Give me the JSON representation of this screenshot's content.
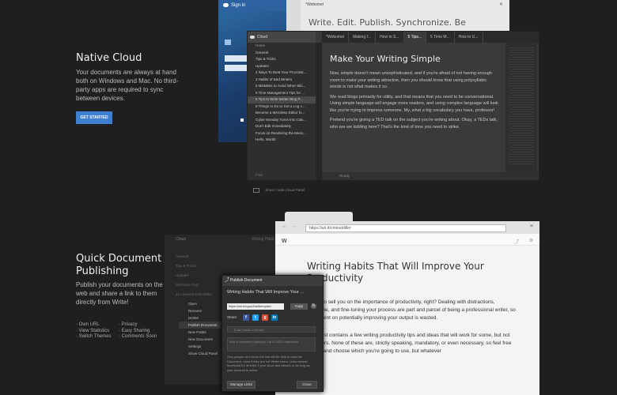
{
  "native": {
    "title": "Native Cloud",
    "text": "Your documents are always at hand both on Windows and Mac. No third-party apps are required to sync between devices.",
    "button": "GET STARTED"
  },
  "quick": {
    "title": "Quick Document Publishing",
    "text": "Publish your documents on the web and share a link to them directly from Write!",
    "features_col1": [
      "· Own URL",
      "· View Statistics",
      "· Switch Themes"
    ],
    "features_col2": [
      "· Privacy",
      "· Easy Sharing",
      "· Comments Soon"
    ]
  },
  "signin": {
    "title": "Sign in"
  },
  "gray_doc": {
    "title": "*Webomel",
    "heading": "Write. Edit. Publish. Synchronize. Be"
  },
  "cloud": {
    "header": "Cloud",
    "home": "Home",
    "items": [
      "General",
      "Tips & Tricks",
      "Updates",
      "4 Ways To Beat Your Procrasti...",
      "3 Habits of Bad Writers",
      "5 Mistakes to Avoid When Blo...",
      "5 Time Management Tips for ...",
      "5 Tips to Write Better Blog P...",
      "8 Things to Do to Get a Log o...",
      "Become a Merciless Editor fo...",
      "Cyber Monday Turns Into Cab...",
      "Don't Edit Immediately",
      "Focus on Rendering the Mess...",
      "Hello, World!"
    ],
    "search_placeholder": "Find"
  },
  "tabs": [
    "*Webomel",
    "Making f...",
    "How to S...",
    "5 Tips...",
    "5 Time M...",
    "How to U..."
  ],
  "editor": {
    "heading": "Make Your Writing Simple",
    "p1": "Now, simple doesn't mean unsophisticated, and if you're afraid of not having enough room to make your writing attractive, then you should know that using polysyllabic words is not what makes it so.",
    "p2": "We read blogs primarily for utility, and that means that you need to be conversational. Using simple language will engage more readers, and using complex language will look like you're trying to impress someone. My, what a big vocabulary you have, professor!",
    "p3": "Pretend you're giving a TED talk on the subject you're writing about. Okay, a TEDx talk, who are we kidding here? That's the kind of tone you need to strike.",
    "status": "Ready",
    "toggle_caption": "Show / Hide Cloud Panel"
  },
  "browser": {
    "url": "https://wri.tt/cmtoutdiller",
    "title": "Writing Habits That Will Improve Your Productivity",
    "p1": "I have to sell you on the importance of productivity, right? Dealing with distractions, discipline, and fine-tuning your process are part and parcel of being a professional writer, so time spent on potentially improving your output is wasted.",
    "p2": "This post contains a few writing productivity tips and ideas that will work for some, but not for others. None of these are, strictly speaking, mandatory, or even necessary, so feel free to pick and choose which you're going to use, but whatever"
  },
  "dim": {
    "cloud": "Cloud",
    "writing": "Writing Habit",
    "items": [
      "General",
      "Tips & Tricks",
      "Updates",
      "Welcome Post",
      "10 Lessons from Writer"
    ]
  },
  "menu": [
    "Open",
    "Rename",
    "Delete",
    "Publish Document",
    "New Folder",
    "New Document",
    "Settings",
    "Show Cloud Panel"
  ],
  "publish": {
    "header": "Publish Document",
    "doc_title": "Writing Habits That Will Improve Your ...",
    "link": "https://wri.tt/cgou2ta/9ekopdev",
    "copy": "Copy",
    "share_label": "Share:",
    "email_placeholder": "Enter email or phone",
    "message_placeholder": "Add a comment (optional). Up to 1000 characters",
    "note": "Only people who know the link will be able to read the Document, even if they are not Write! users. Links remain functional for at least 1 year since last viewed or as long as your account is active.",
    "manage": "Manage Links",
    "close": "Close"
  },
  "colors": {
    "accent": "#3d7fd1",
    "facebook": "#3b5998",
    "twitter": "#1da1f2",
    "google": "#dd4b39",
    "linkedin": "#0077b5"
  }
}
